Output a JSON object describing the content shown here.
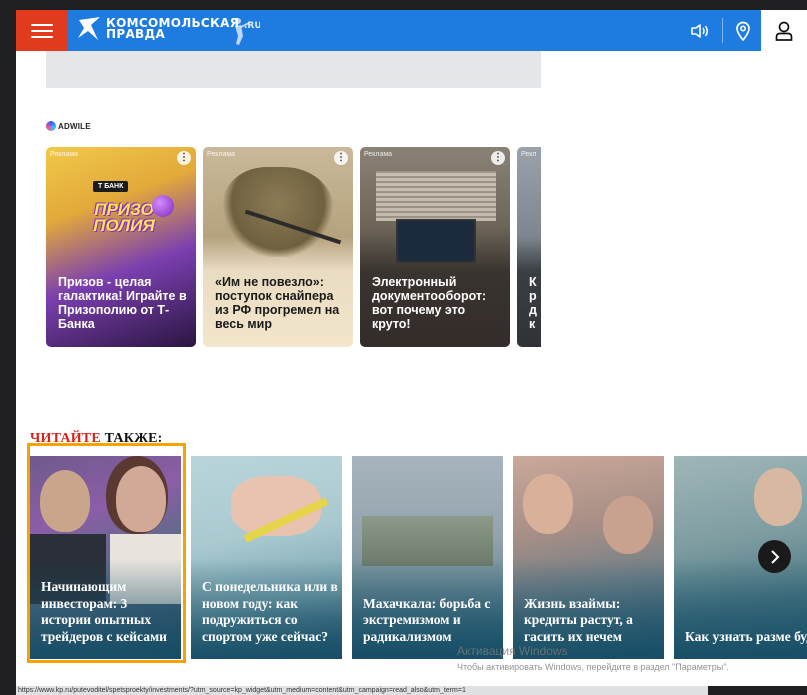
{
  "header": {
    "logo_line1": "КОМСОМОЛЬСКАЯ",
    "logo_line2": "ПРАВДА",
    "logo_ru": ".RU",
    "colors": {
      "bar": "#1e7be0",
      "menu": "#e23a1e"
    },
    "icons": [
      "menu-icon",
      "speaker-icon",
      "location-pin-icon",
      "user-icon"
    ]
  },
  "adwile": {
    "brand": "ADWILE",
    "items": [
      {
        "tag": "Реклама",
        "title": "Призов - целая галактика! Играйте в Призополию от Т-Банка",
        "art_bank": "Т БАНК",
        "art_text": "ПРИЗО ПОЛИЯ"
      },
      {
        "tag": "Реклама",
        "title": "«Им не повезло»: поступок снайпера из РФ прогремел на весь мир"
      },
      {
        "tag": "Реклама",
        "title": "Электронный документооборот: вот почему это круто!"
      },
      {
        "tag": "Рекл",
        "title": "К р д к"
      }
    ]
  },
  "read_also": {
    "label_red": "ЧИТАЙТЕ",
    "label_black": " ТАКЖЕ:",
    "cards": [
      {
        "title": "Начинающим инвесторам: 3 истории опытных трейдеров с кейсами"
      },
      {
        "title": "С понедельника или в новом году: как подружиться со спортом уже сейчас?"
      },
      {
        "title": "Махачкала: борьба с экстремизмом и радикализмом"
      },
      {
        "title": "Жизнь взаймы: кредиты растут, а гасить их нечем"
      },
      {
        "title": "Как узнать разме будущей пенсии?"
      }
    ]
  },
  "windows": {
    "line1": "Активация Windows",
    "line2": "Чтобы активировать Windows, перейдите в раздел \"Параметры\"."
  },
  "status_url": "https://www.kp.ru/putevoditel/spetsproekty/investments/?utm_source=kp_widget&utm_medium=content&utm_campaign=read_also&utm_term=1"
}
